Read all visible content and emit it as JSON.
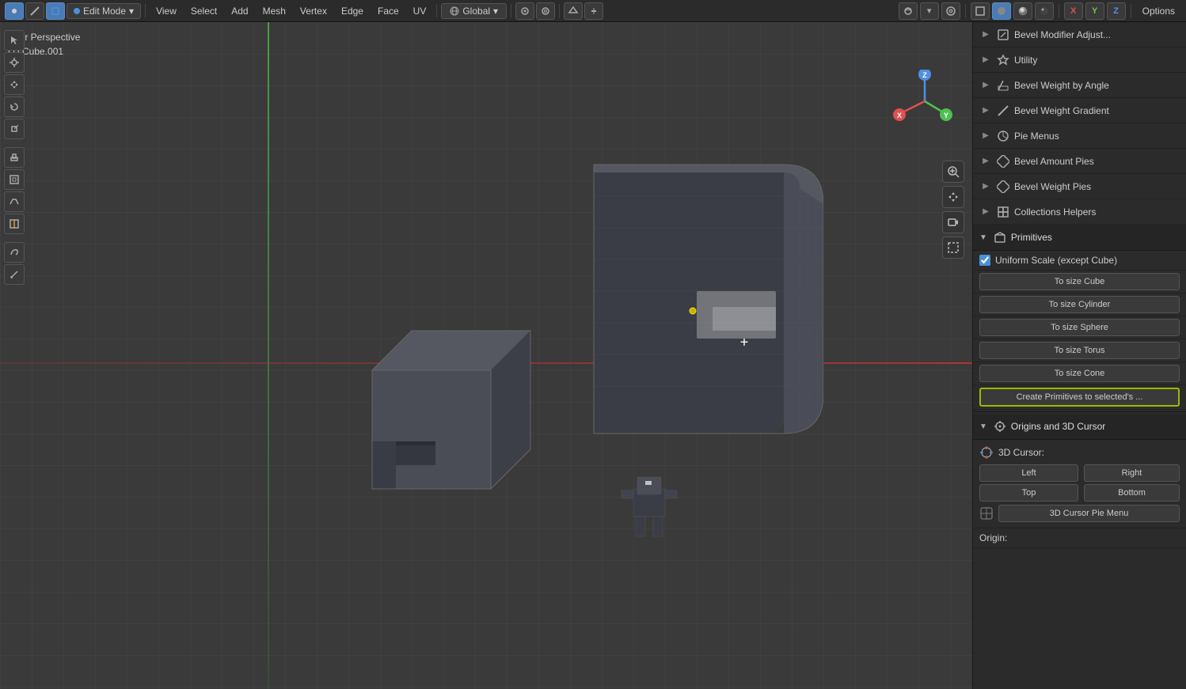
{
  "app": {
    "mode": "Edit Mode",
    "viewport_label": "User Perspective",
    "viewport_sublabel": "(1) Cube.001"
  },
  "toolbar": {
    "mode_label": "Edit Mode",
    "view_label": "View",
    "select_label": "Select",
    "add_label": "Add",
    "mesh_label": "Mesh",
    "vertex_label": "Vertex",
    "edge_label": "Edge",
    "face_label": "Face",
    "uv_label": "UV",
    "global_label": "Global",
    "options_label": "Options",
    "x_label": "X",
    "y_label": "Y",
    "z_label": "Z"
  },
  "right_panel": {
    "items": [
      {
        "id": "bevel-modifier",
        "label": "Bevel Modifier Adjust...",
        "expanded": false,
        "icon": "cube-icon"
      },
      {
        "id": "utility",
        "label": "Utility",
        "expanded": false,
        "icon": "tool-icon"
      },
      {
        "id": "bevel-weight-angle",
        "label": "Bevel Weight by Angle",
        "expanded": false,
        "icon": "corner-icon"
      },
      {
        "id": "bevel-weight-gradient",
        "label": "Bevel Weight Gradient",
        "expanded": false,
        "icon": "line-icon"
      },
      {
        "id": "pie-menus",
        "label": "Pie Menus",
        "expanded": false,
        "icon": "circle-icon"
      },
      {
        "id": "bevel-amount-pies",
        "label": "Bevel Amount Pies",
        "expanded": false,
        "icon": "diamond-icon"
      },
      {
        "id": "bevel-weight-pies",
        "label": "Bevel Weight Pies",
        "expanded": false,
        "icon": "diamond-icon"
      },
      {
        "id": "collections-helpers",
        "label": "Collections Helpers",
        "expanded": false,
        "icon": "layers-icon"
      }
    ],
    "primitives": {
      "label": "Primitives",
      "expanded": true,
      "icon": "cube-icon",
      "uniform_scale_checked": true,
      "uniform_scale_label": "Uniform Scale (except Cube)",
      "size_buttons": [
        {
          "id": "to-size-cube",
          "label": "To size Cube"
        },
        {
          "id": "to-size-cylinder",
          "label": "To size Cylinder"
        },
        {
          "id": "to-size-sphere",
          "label": "To size Sphere"
        },
        {
          "id": "to-size-torus",
          "label": "To size Torus"
        },
        {
          "id": "to-size-cone",
          "label": "To size Cone"
        }
      ],
      "create_button": "Create Primitives to selected's ..."
    },
    "origins": {
      "label": "Origins and 3D Cursor",
      "expanded": true,
      "icon": "origin-icon",
      "cursor_3d_label": "3D Cursor:",
      "cursor_icon": "cursor-icon",
      "left_label": "Left",
      "right_label": "Right",
      "top_label": "Top",
      "bottom_label": "Bottom",
      "pie_menu_label": "3D Cursor Pie Menu",
      "origin_label": "Origin:"
    }
  }
}
